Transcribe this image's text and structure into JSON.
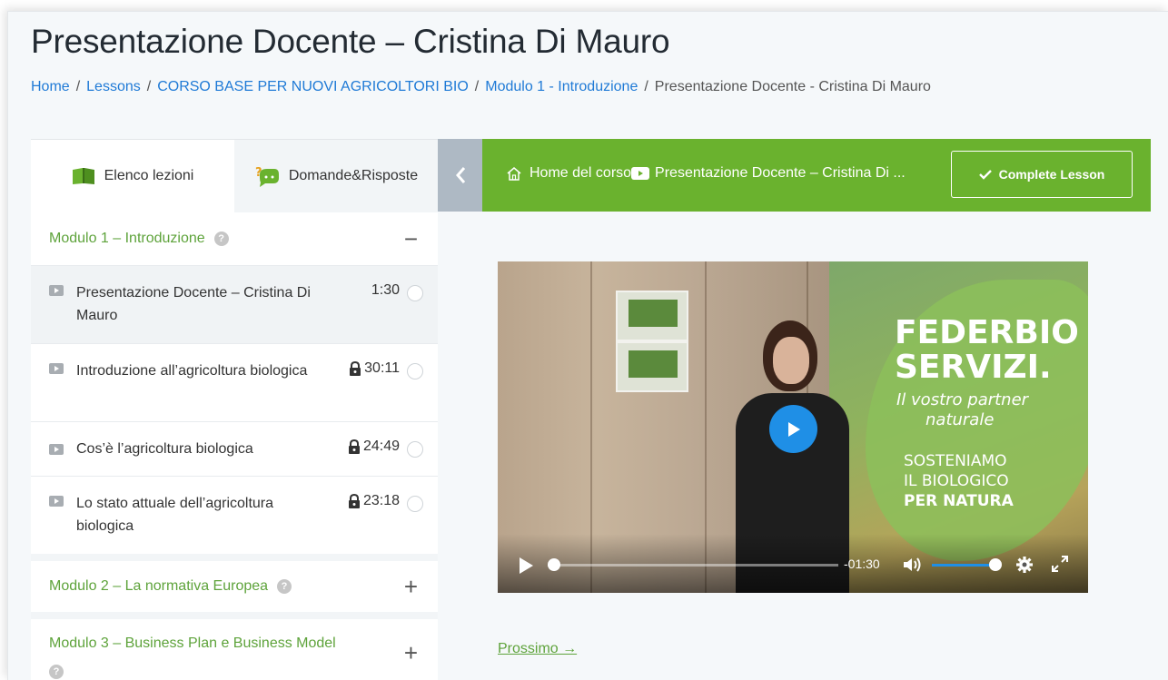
{
  "page": {
    "title": "Presentazione Docente – Cristina Di Mauro"
  },
  "breadcrumb": {
    "items": [
      "Home",
      "Lessons",
      "CORSO BASE PER NUOVI AGRICOLTORI BIO",
      "Modulo 1 - Introduzione"
    ],
    "current": "Presentazione Docente - Cristina Di Mauro",
    "separator": "/"
  },
  "sidebar": {
    "tabs": [
      {
        "label": "Elenco lezioni",
        "icon": "book-icon",
        "active": true
      },
      {
        "label": "Domande&Risposte",
        "icon": "question-answer-icon",
        "active": false
      }
    ],
    "modules": [
      {
        "title": "Modulo 1 – Introduzione",
        "toggle": "−",
        "expanded": true,
        "lessons": [
          {
            "title": "Presentazione Docente – Cristina Di Mauro",
            "duration": "1:30",
            "locked": false,
            "current": true
          },
          {
            "title": "Introduzione all’agricoltura biologica",
            "duration": "30:11",
            "locked": true,
            "current": false
          },
          {
            "title": "Cos’è l’agricoltura biologica",
            "duration": "24:49",
            "locked": true,
            "current": false
          },
          {
            "title": "Lo stato attuale dell’agricoltura biologica",
            "duration": "23:18",
            "locked": true,
            "current": false
          }
        ]
      },
      {
        "title": "Modulo 2 – La normativa Europea",
        "toggle": "+",
        "expanded": false
      },
      {
        "title": "Modulo 3 – Business Plan e Business Model",
        "toggle": "+",
        "expanded": false
      }
    ],
    "help_glyph": "?"
  },
  "topbar": {
    "back_glyph": "‹",
    "home_label": "Home del corso",
    "current_label": "Presentazione Docente – Cristina Di ...",
    "complete_label": "Complete Lesson"
  },
  "video": {
    "poster_text": [
      "FEDERBIO",
      "SERVIZI.",
      "Il vostro partner",
      "naturale",
      "SOSTENIAMO",
      "IL BIOLOGICO",
      "PER NATURA"
    ],
    "time_remaining": "-01:30",
    "progress": 0,
    "volume": 1.0
  },
  "next": {
    "label": "Prossimo →"
  },
  "colors": {
    "green": "#6ab22e",
    "link_blue": "#1f7ad6",
    "module_green": "#5ea33b",
    "play_blue": "#1f8fe6"
  }
}
